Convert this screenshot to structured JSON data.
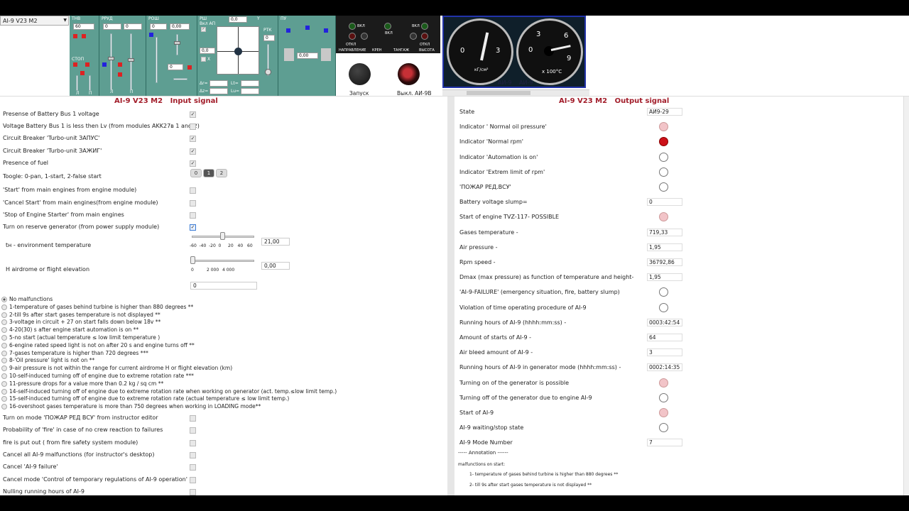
{
  "combo": {
    "value": "AI-9 V23 M2"
  },
  "panels": {
    "tnv": "TНВ",
    "tnv_val": "60",
    "rrud": "РРУД",
    "rrud_v1": "0",
    "rrud_v2": "0",
    "rosh": "РОШ",
    "rosh_v1": "0",
    "rosh_v2": "0,00",
    "rosh_v3": "0",
    "stop": "СТОП",
    "l": "Л",
    "p": "П",
    "rsh": "РШ",
    "vkl_ap": "Вкл АП",
    "rsh_v": "0,0",
    "x": "X",
    "y": "Y",
    "center_val": "0,0",
    "rtk": "РТК",
    "rtk_v": "0",
    "pu": "ПУ",
    "pu_v": "0,00",
    "dr": "Δr=",
    "dz": "Δz=",
    "lt": "Lt=",
    "lu": "Lu="
  },
  "instr": {
    "vkl1": "ВКЛ",
    "vkl2": "ВКЛ",
    "vkl3": "ВКЛ",
    "otkl1": "ОТКЛ",
    "otkl2": "ОТКЛ",
    "napr": "НАПРАВЛЕНИЕ",
    "kren": "КРЕН",
    "tangazh": "ТАНГАЖ",
    "vysota": "ВЫСОТА",
    "zapusk": "Запуск",
    "vykl": "Выкл. АИ-9В"
  },
  "gauges": {
    "g1_0": "0",
    "g1_3": "3",
    "g1_unit": "кГ/см²",
    "g2_0": "0",
    "g2_3": "3",
    "g2_6": "6",
    "g2_9": "9",
    "g2_unit": "x 100°C",
    "label": "АИ-9"
  },
  "input": {
    "title": "AI-9 V23 M2",
    "title2": "Input signal",
    "rows": [
      "Presense of Battery Bus 1 voltage",
      "Voltage Battery Bus 1 is less then Lv (from modules AKK27в 1 and 2)",
      "Circuit Breaker 'Turbo-unit ЗАПУС'",
      "Circuit Breaker 'Turbo-unit ЗАЖИГ'",
      "Presence of fuel",
      "Toogle: 0-pan, 1-start, 2-false start",
      "'Start' from main engines from engine module)",
      "'Cancel Start' from main engines(from engine module)",
      "'Stop of Engine Starter' from main engines",
      "Turn on reserve generator (from power supply module)",
      "tн - environment temperature",
      "H airdrome or flight elevation"
    ],
    "toggle": [
      "0",
      "1",
      "2"
    ],
    "temp_ticks": [
      "-60",
      "-40",
      "-20",
      "0",
      "20",
      "40",
      "60"
    ],
    "temp_val": "21,00",
    "elev_ticks": [
      "0",
      "2 000",
      "4 000"
    ],
    "elev_val": "0,00",
    "free_val": "0",
    "malfunctions": [
      "No malfunctions",
      "1-temperature of gases behind turbine is higher than 880 degrees **",
      "2-till 9s after start gases temperature is not displayed **",
      "3-voltage in circuit + 27 on start falls down below 18v **",
      "4-20(30) s after engine start automation is on **",
      "5-no start (actual temperature ≤ low limit temperature )",
      "6-engine rated speed light is not on after 20 s and engine turns off **",
      "7-gases temperature is higher than 720 degrees ***",
      "8-'Oil pressure' light is not on **",
      "9-air pressure is not within the range for current airdrome H or flight elevation (km)",
      "10-self-induced turning off of engine due to extreme rotation rate ***",
      "11-pressure drops for a value more than 0.2 kg / sq cm **",
      "14-self-induced turning off of engine due to extreme rotation rate when working on generator (act. temp.≤low limit temp.)",
      "15-self-induced turning off of engine due to extreme rotation rate (actual temperature ≤ low limit temp.)",
      "16-overshoot gases temperature is more than 750 degrees when working in LOADING mode**"
    ],
    "rows2": [
      "Turn on mode 'ПОЖАР РЕД ВСУ' from instructor editor",
      "Probability of 'fire' in case of no crew reaction to failures",
      "fire is put out ( from fire safety system module)",
      "Cancel all AI-9 malfunctions (for instructor's desktop)",
      "Cancel 'AI-9 failure'",
      "Cancel mode 'Control of temporary regulations of AI-9 operation'",
      "Nulling running hours of AI-9"
    ]
  },
  "output": {
    "title": "AI-9 V23 M2",
    "title2": "Output signal",
    "rows": [
      {
        "label": "State",
        "value": "АИ9-29"
      },
      {
        "label": "Indicator ' Normal oil pressure'",
        "ind": "pink"
      },
      {
        "label": "Indicator 'Normal rpm'",
        "ind": "red"
      },
      {
        "label": "Indicator 'Automation is on'",
        "ind": "off"
      },
      {
        "label": "Indicator 'Extrem limit of rpm'",
        "ind": "off"
      },
      {
        "label": "'ПОЖАР РЕД.ВСУ'",
        "ind": "off"
      },
      {
        "label": "Battery voltage slump=",
        "value": "0"
      },
      {
        "label": "Start of engine TVZ-117- POSSIBLE",
        "ind": "pink"
      },
      {
        "label": "Gases temperature -",
        "value": "719,33"
      },
      {
        "label": "Air pressure -",
        "value": "1,95"
      },
      {
        "label": "Rpm speed -",
        "value": "36792,86"
      },
      {
        "label": "Dmax (max pressure) as function of temperature and height-",
        "value": "1,95"
      },
      {
        "label": "'AI-9-FAILURE' (emergency situation, fire, battery slump)",
        "ind": "off"
      },
      {
        "label": "Violation of time operating procedure of AI-9",
        "ind": "off"
      },
      {
        "label": "Running hours of AI-9 (hhhh:mm:ss) -",
        "value": "0003:42:54"
      },
      {
        "label": "Amount of starts of AI-9 -",
        "value": "64"
      },
      {
        "label": "Air bleed amount of AI-9 -",
        "value": "3"
      },
      {
        "label": "Running hours of AI-9 in generator mode (hhhh:mm:ss) -",
        "value": "0002:14:35"
      },
      {
        "label": "Turning on of the generator is possible",
        "ind": "pink"
      },
      {
        "label": "Turning off of the generator due to engine AI-9",
        "ind": "off"
      },
      {
        "label": "Start of AI-9",
        "ind": "pink"
      },
      {
        "label": "AI-9 waiting/stop state",
        "ind": "off"
      },
      {
        "label": "AI-9 Mode Number",
        "value": "7"
      }
    ],
    "annotation": "----- Annotation ------",
    "mal_on_start": "malfunctions on start:",
    "note1": "1- temperature of gases behind turbine is higher than 880 degrees **",
    "note2": "2- till 9s after start gases temperature is not displayed **"
  },
  "colors": {
    "panel": "#5e9e92",
    "header_text": "#a21d2a",
    "indicator_red": "#cc1018",
    "indicator_pink": "#f2c4c8"
  }
}
